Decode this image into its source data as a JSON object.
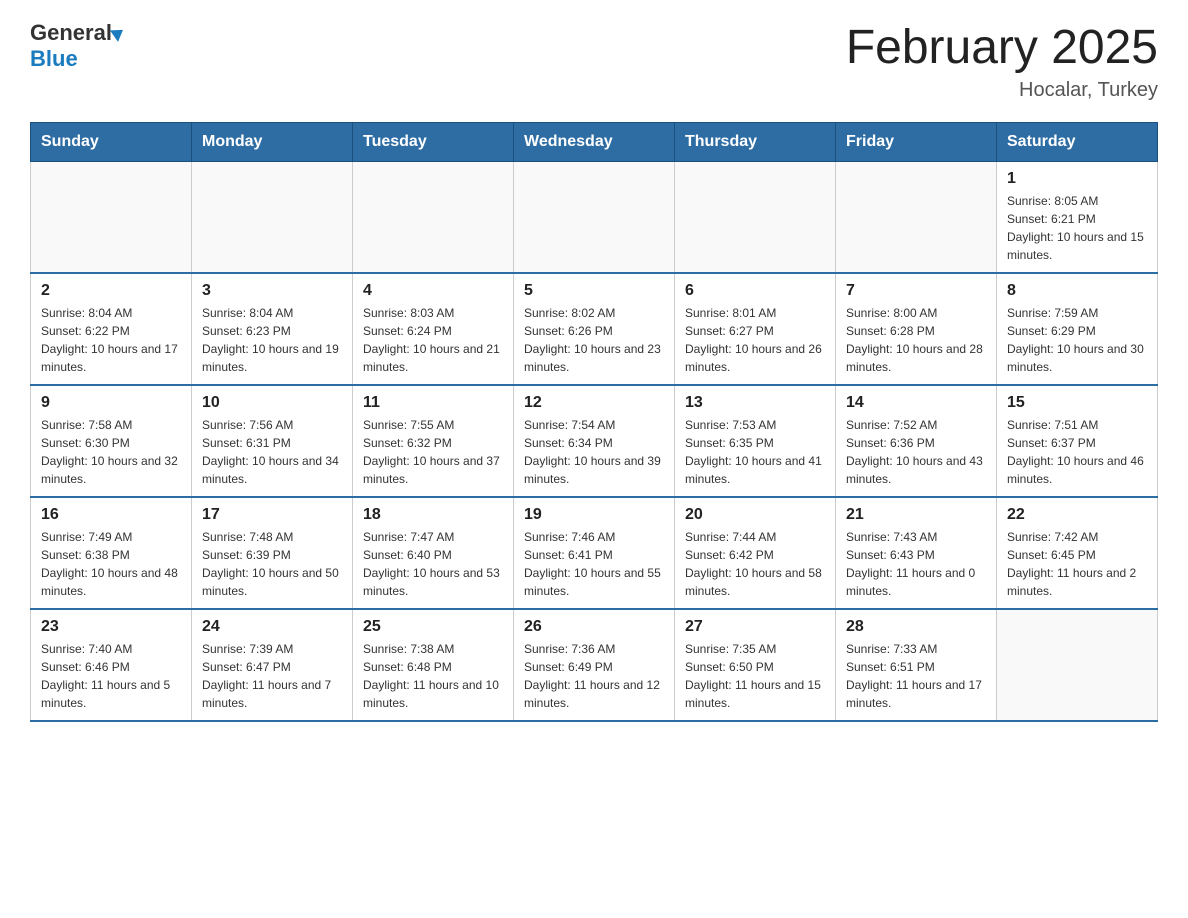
{
  "header": {
    "logo_general": "General",
    "logo_blue": "Blue",
    "month_title": "February 2025",
    "location": "Hocalar, Turkey"
  },
  "weekdays": [
    "Sunday",
    "Monday",
    "Tuesday",
    "Wednesday",
    "Thursday",
    "Friday",
    "Saturday"
  ],
  "weeks": [
    [
      {
        "day": "",
        "info": ""
      },
      {
        "day": "",
        "info": ""
      },
      {
        "day": "",
        "info": ""
      },
      {
        "day": "",
        "info": ""
      },
      {
        "day": "",
        "info": ""
      },
      {
        "day": "",
        "info": ""
      },
      {
        "day": "1",
        "info": "Sunrise: 8:05 AM\nSunset: 6:21 PM\nDaylight: 10 hours and 15 minutes."
      }
    ],
    [
      {
        "day": "2",
        "info": "Sunrise: 8:04 AM\nSunset: 6:22 PM\nDaylight: 10 hours and 17 minutes."
      },
      {
        "day": "3",
        "info": "Sunrise: 8:04 AM\nSunset: 6:23 PM\nDaylight: 10 hours and 19 minutes."
      },
      {
        "day": "4",
        "info": "Sunrise: 8:03 AM\nSunset: 6:24 PM\nDaylight: 10 hours and 21 minutes."
      },
      {
        "day": "5",
        "info": "Sunrise: 8:02 AM\nSunset: 6:26 PM\nDaylight: 10 hours and 23 minutes."
      },
      {
        "day": "6",
        "info": "Sunrise: 8:01 AM\nSunset: 6:27 PM\nDaylight: 10 hours and 26 minutes."
      },
      {
        "day": "7",
        "info": "Sunrise: 8:00 AM\nSunset: 6:28 PM\nDaylight: 10 hours and 28 minutes."
      },
      {
        "day": "8",
        "info": "Sunrise: 7:59 AM\nSunset: 6:29 PM\nDaylight: 10 hours and 30 minutes."
      }
    ],
    [
      {
        "day": "9",
        "info": "Sunrise: 7:58 AM\nSunset: 6:30 PM\nDaylight: 10 hours and 32 minutes."
      },
      {
        "day": "10",
        "info": "Sunrise: 7:56 AM\nSunset: 6:31 PM\nDaylight: 10 hours and 34 minutes."
      },
      {
        "day": "11",
        "info": "Sunrise: 7:55 AM\nSunset: 6:32 PM\nDaylight: 10 hours and 37 minutes."
      },
      {
        "day": "12",
        "info": "Sunrise: 7:54 AM\nSunset: 6:34 PM\nDaylight: 10 hours and 39 minutes."
      },
      {
        "day": "13",
        "info": "Sunrise: 7:53 AM\nSunset: 6:35 PM\nDaylight: 10 hours and 41 minutes."
      },
      {
        "day": "14",
        "info": "Sunrise: 7:52 AM\nSunset: 6:36 PM\nDaylight: 10 hours and 43 minutes."
      },
      {
        "day": "15",
        "info": "Sunrise: 7:51 AM\nSunset: 6:37 PM\nDaylight: 10 hours and 46 minutes."
      }
    ],
    [
      {
        "day": "16",
        "info": "Sunrise: 7:49 AM\nSunset: 6:38 PM\nDaylight: 10 hours and 48 minutes."
      },
      {
        "day": "17",
        "info": "Sunrise: 7:48 AM\nSunset: 6:39 PM\nDaylight: 10 hours and 50 minutes."
      },
      {
        "day": "18",
        "info": "Sunrise: 7:47 AM\nSunset: 6:40 PM\nDaylight: 10 hours and 53 minutes."
      },
      {
        "day": "19",
        "info": "Sunrise: 7:46 AM\nSunset: 6:41 PM\nDaylight: 10 hours and 55 minutes."
      },
      {
        "day": "20",
        "info": "Sunrise: 7:44 AM\nSunset: 6:42 PM\nDaylight: 10 hours and 58 minutes."
      },
      {
        "day": "21",
        "info": "Sunrise: 7:43 AM\nSunset: 6:43 PM\nDaylight: 11 hours and 0 minutes."
      },
      {
        "day": "22",
        "info": "Sunrise: 7:42 AM\nSunset: 6:45 PM\nDaylight: 11 hours and 2 minutes."
      }
    ],
    [
      {
        "day": "23",
        "info": "Sunrise: 7:40 AM\nSunset: 6:46 PM\nDaylight: 11 hours and 5 minutes."
      },
      {
        "day": "24",
        "info": "Sunrise: 7:39 AM\nSunset: 6:47 PM\nDaylight: 11 hours and 7 minutes."
      },
      {
        "day": "25",
        "info": "Sunrise: 7:38 AM\nSunset: 6:48 PM\nDaylight: 11 hours and 10 minutes."
      },
      {
        "day": "26",
        "info": "Sunrise: 7:36 AM\nSunset: 6:49 PM\nDaylight: 11 hours and 12 minutes."
      },
      {
        "day": "27",
        "info": "Sunrise: 7:35 AM\nSunset: 6:50 PM\nDaylight: 11 hours and 15 minutes."
      },
      {
        "day": "28",
        "info": "Sunrise: 7:33 AM\nSunset: 6:51 PM\nDaylight: 11 hours and 17 minutes."
      },
      {
        "day": "",
        "info": ""
      }
    ]
  ]
}
